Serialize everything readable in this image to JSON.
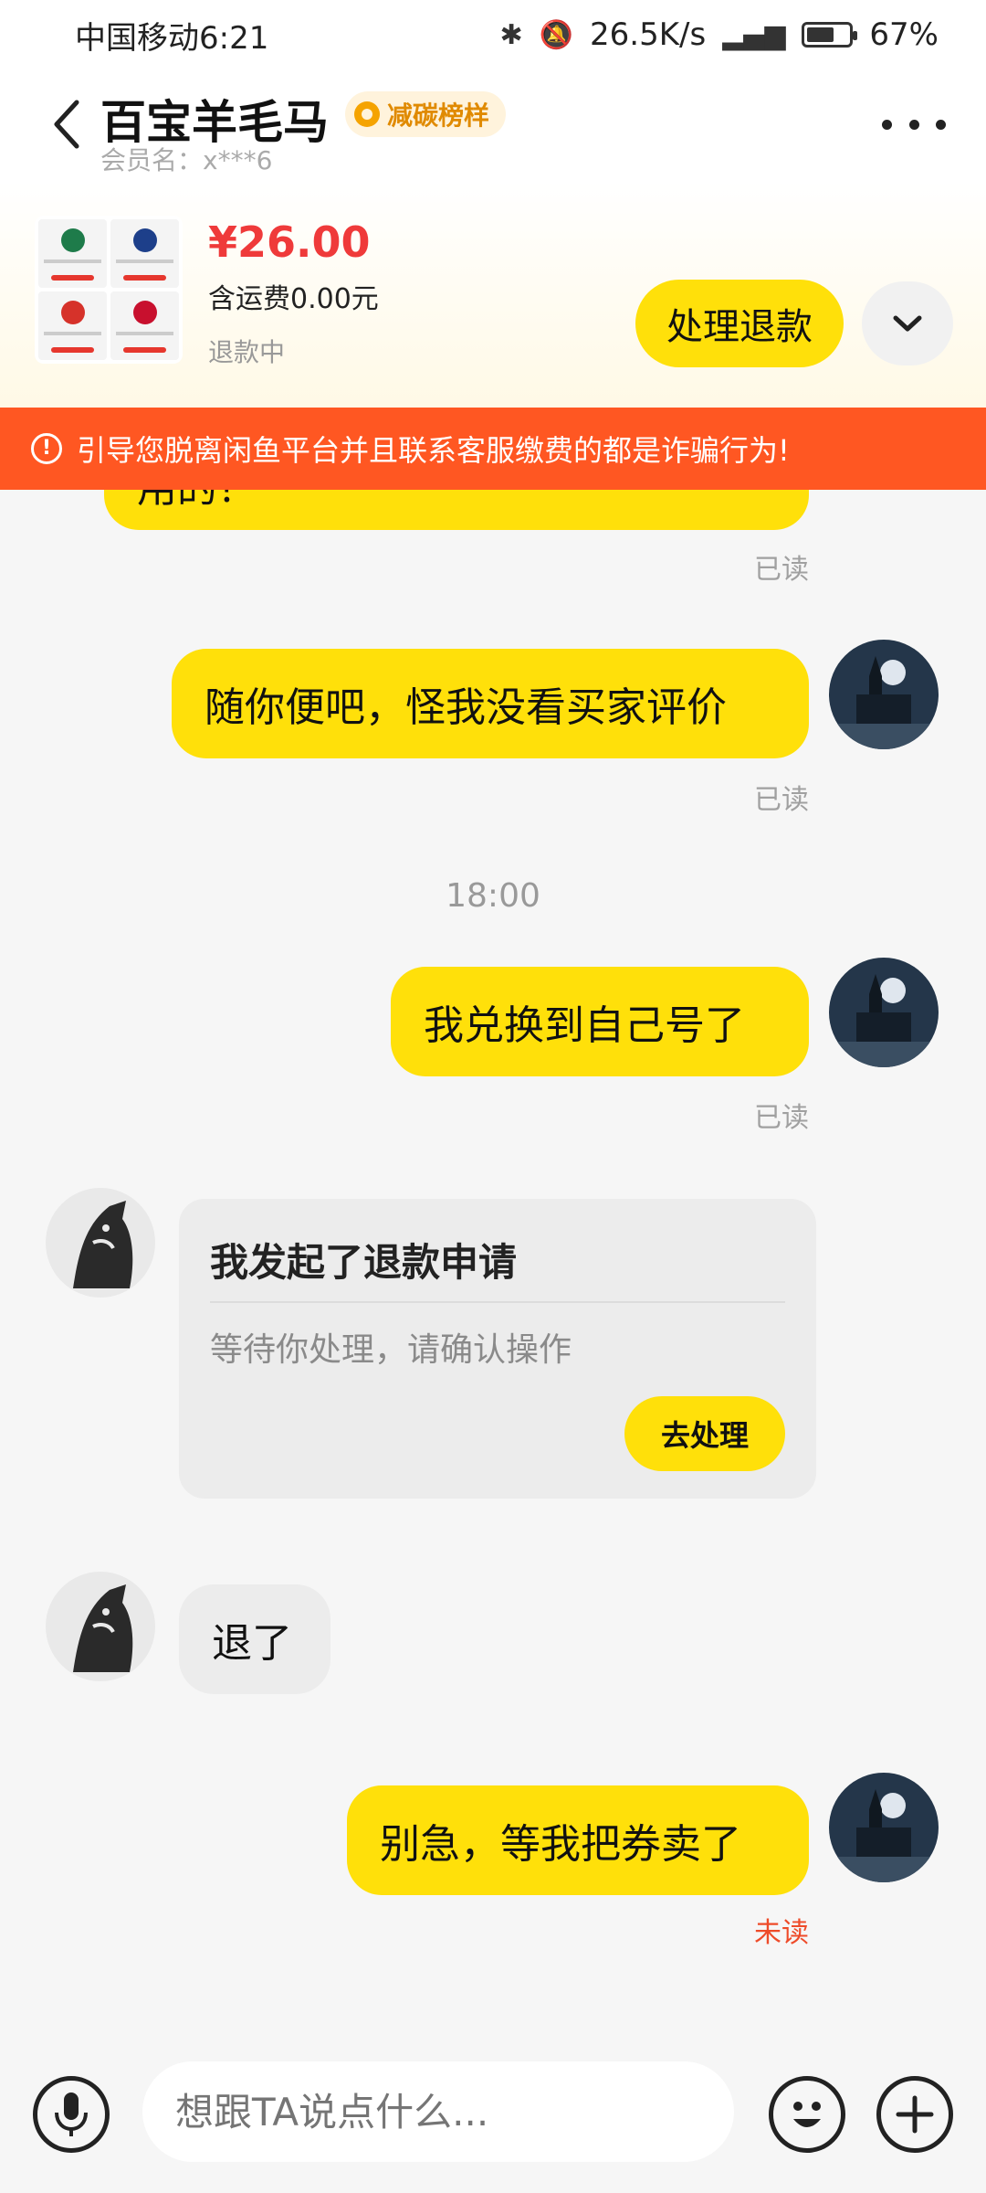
{
  "status_bar": {
    "carrier_time": "中国移动6:21",
    "speed": "26.5K/s",
    "battery": "67%",
    "battery_level": 0.67
  },
  "header": {
    "title": "百宝羊毛马",
    "badge": "减碳榜样",
    "member": "会员名：x***6"
  },
  "product": {
    "price": "¥26.00",
    "shipping": "含运费0.00元",
    "status": "退款中",
    "action_label": "处理退款"
  },
  "warning": {
    "text": "引导您脱离闲鱼平台并且联系客服缴费的都是诈骗行为!"
  },
  "chat": {
    "partial_message": "用的？",
    "partial_read": "已读",
    "messages": [
      {
        "text": "随你便吧，怪我没看买家评价",
        "read": "已读"
      },
      {
        "text": "我兑换到自己号了",
        "read": "已读"
      }
    ],
    "timestamp": "18:00",
    "refund_card": {
      "title": "我发起了退款申请",
      "desc": "等待你处理，请确认操作",
      "button": "去处理"
    },
    "other_message": "退了",
    "last_message": {
      "text": "别急，等我把券卖了",
      "read": "未读"
    }
  },
  "input": {
    "placeholder": "想跟TA说点什么..."
  },
  "colors": {
    "accent_yellow": "#ffe00a",
    "warning_orange": "#ff5722",
    "price_red": "#ef3a3a",
    "unread_red": "#ee4b29"
  }
}
